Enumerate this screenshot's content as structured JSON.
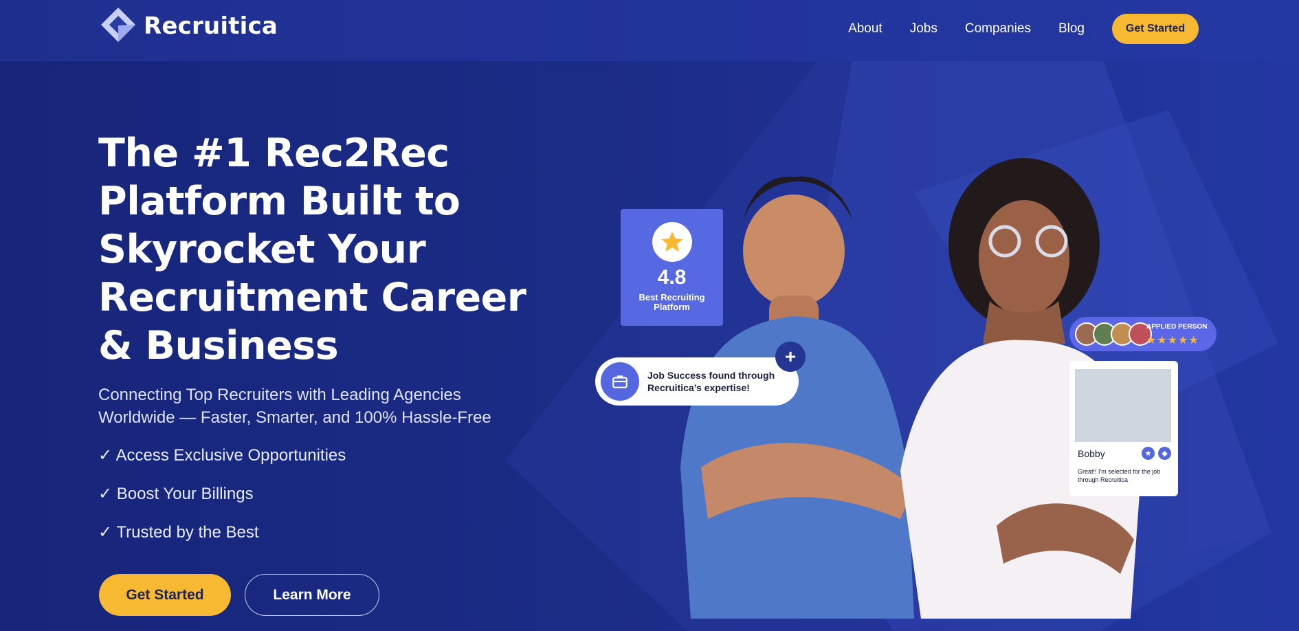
{
  "brand": {
    "name": "Recruitica"
  },
  "nav": {
    "items": [
      "About",
      "Jobs",
      "Companies",
      "Blog"
    ],
    "cta": "Get Started"
  },
  "hero": {
    "headline": "The #1 Rec2Rec Platform Built to Skyrocket Your Recruitment Career & Business",
    "subhead": "Connecting Top Recruiters with Leading Agencies Worldwide — Faster, Smarter, and 100% Hassle-Free",
    "bullets": [
      "✓ Access Exclusive Opportunities",
      "✓ Boost Your Billings",
      "✓ Trusted by the Best"
    ],
    "primary_cta": "Get Started",
    "secondary_cta": "Learn More"
  },
  "cards": {
    "rating": {
      "value": "4.8",
      "label": "Best Recruiting Platform"
    },
    "job_success": "Job Success found through Recruitica’s expertise!",
    "applied": {
      "label": "APPLIED PERSON",
      "stars": "★★★★★"
    },
    "bobby": {
      "name": "Bobby",
      "message": "Great!! I'm selected for the job through Recruitica"
    }
  },
  "colors": {
    "accent": "#f7b932",
    "primary": "#1b2c86",
    "card": "#5668e2"
  }
}
